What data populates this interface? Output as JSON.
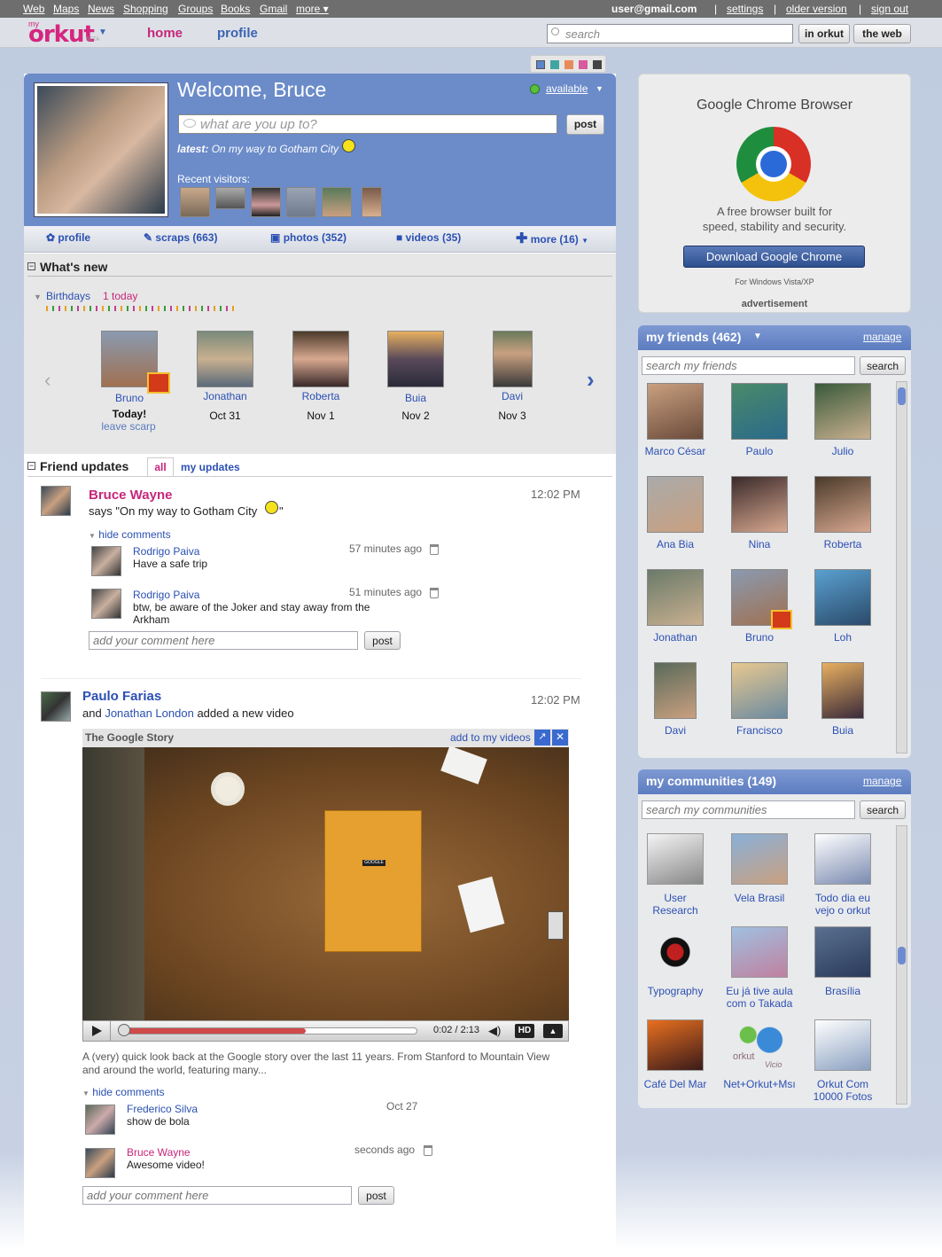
{
  "google_bar": {
    "links": [
      "Web",
      "Maps",
      "News",
      "Shopping",
      "Groups",
      "Books",
      "Gmail",
      "more ▾"
    ],
    "user": "user@gmail.com",
    "settings": "settings",
    "older_version": "older version",
    "sign_out": "sign out",
    "sep": "|"
  },
  "header": {
    "logo": "orkut",
    "logo_my": "my",
    "beta": "BETA",
    "nav_home": "home",
    "nav_profile": "profile",
    "search_placeholder": "search",
    "btn_in_orkut": "in orkut",
    "btn_the_web": "the web"
  },
  "theme_colors": [
    "#5b84c9",
    "#3fa6a2",
    "#e88b5a",
    "#d65a9c",
    "#444444"
  ],
  "profile": {
    "welcome": "Welcome, Bruce",
    "status": "available",
    "status_placeholder": "what are you up to?",
    "post": "post",
    "latest_label": "latest:",
    "latest_text": "On my way to Gotham City",
    "recent_visitors": "Recent visitors:"
  },
  "tabs": {
    "profile": "profile",
    "scraps": "scraps (663)",
    "photos": "photos (352)",
    "videos": "videos (35)",
    "more": "more (16)"
  },
  "whats_new": {
    "title": "What's new",
    "birthdays": "Birthdays",
    "today_count": "1 today",
    "people": [
      {
        "name": "Bruno",
        "date": "Today!",
        "extra": "leave scarp"
      },
      {
        "name": "Jonathan",
        "date": "Oct 31"
      },
      {
        "name": "Roberta",
        "date": "Nov 1"
      },
      {
        "name": "Buia",
        "date": "Nov 2"
      },
      {
        "name": "Davi",
        "date": "Nov 3"
      }
    ]
  },
  "friend_updates": {
    "title": "Friend updates",
    "tab_all": "all",
    "tab_mine": "my updates",
    "u1": {
      "name": "Bruce Wayne",
      "text": "says \"On my way to Gotham City",
      "text_end": "\"",
      "time": "12:02 PM",
      "hide": "hide comments",
      "c1": {
        "name": "Rodrigo Paiva",
        "text": "Have a safe trip",
        "time": "57 minutes ago"
      },
      "c2": {
        "name": "Rodrigo Paiva",
        "text": "btw, be aware of the Joker and stay away from the Arkham",
        "time": "51 minutes ago"
      },
      "placeholder": "add your comment here",
      "post": "post"
    },
    "u2": {
      "name": "Paulo Farias",
      "pre": "and",
      "friend": "Jonathan London",
      "text": "added a new video",
      "time": "12:02 PM",
      "video_title": "The Google Story",
      "add_to": "add to my videos",
      "video_time": "0:02 / 2:13",
      "video_progress": 0.62,
      "hd": "HD",
      "notebook_label": "GOOGLE",
      "desc": "A (very) quick look back at the Google story over the last 11 years. From Stanford to Mountain View and around the world, featuring many...",
      "hide": "hide comments",
      "c1": {
        "name": "Frederico Silva",
        "text": "show de bola",
        "time": "Oct 27"
      },
      "c2": {
        "name": "Bruce Wayne",
        "text": "Awesome video!",
        "time": "seconds ago"
      },
      "placeholder": "add your comment here",
      "post": "post"
    }
  },
  "ad": {
    "title": "Google Chrome Browser",
    "desc1": "A free browser built for",
    "desc2": "speed, stability and security.",
    "button": "Download Google Chrome",
    "note": "For Windows Vista/XP",
    "label": "advertisement"
  },
  "friends": {
    "title": "my friends (462)",
    "manage": "manage",
    "placeholder": "search my friends",
    "search": "search",
    "items": [
      "Marco César",
      "Paulo",
      "Julio",
      "Ana Bia",
      "Nina",
      "Roberta",
      "Jonathan",
      "Bruno",
      "Loh",
      "Davi",
      "Francisco",
      "Buia"
    ]
  },
  "communities": {
    "title": "my communities (149)",
    "manage": "manage",
    "placeholder": "search my communities",
    "search": "search",
    "items": [
      [
        "User",
        "Research"
      ],
      [
        "Vela Brasil",
        ""
      ],
      [
        "Todo dia eu",
        "vejo o orkut"
      ],
      [
        "Typography",
        ""
      ],
      [
        "Eu já tive aula",
        "com o Takada"
      ],
      [
        "Brasília",
        ""
      ],
      [
        "Café Del Mar",
        ""
      ],
      [
        "Net+Orkut+Msı",
        ""
      ],
      [
        "Orkut Com",
        "10000 Fotos"
      ]
    ],
    "logo_text": [
      "orkut",
      "Vicio"
    ]
  }
}
